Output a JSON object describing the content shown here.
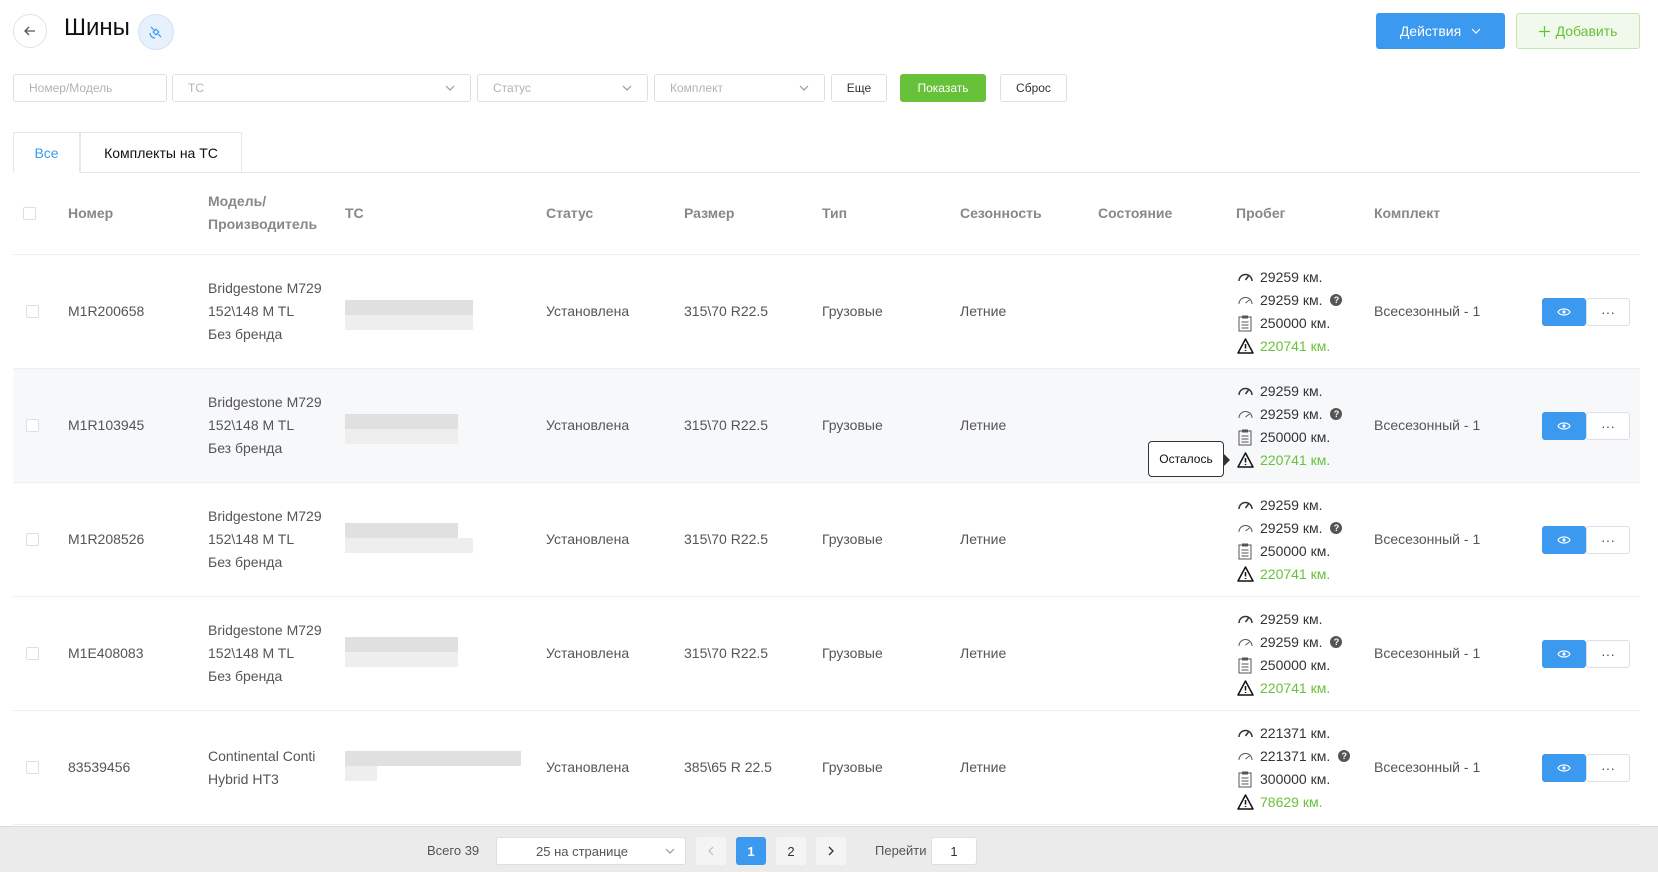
{
  "header": {
    "title": "Шины",
    "actions_label": "Действия",
    "add_label": "Добавить"
  },
  "filters": {
    "number_model_placeholder": "Номер/Модель",
    "vehicle_placeholder": "ТС",
    "status_placeholder": "Статус",
    "set_placeholder": "Комплект",
    "more_label": "Еще",
    "show_label": "Показать",
    "reset_label": "Сброс"
  },
  "tabs": [
    {
      "label": "Все",
      "active": true
    },
    {
      "label": "Комплекты на ТС",
      "active": false
    }
  ],
  "table": {
    "columns": [
      "Номер",
      "Модель/Производитель",
      "ТС",
      "Статус",
      "Размер",
      "Тип",
      "Сезонность",
      "Состояние",
      "Пробег",
      "Комплект"
    ],
    "rows": [
      {
        "number": "M1R200658",
        "model": [
          "Bridgestone M729",
          "152\\148 M TL",
          "Без бренда"
        ],
        "status": "Установлена",
        "size": "315\\70 R22.5",
        "type": "Грузовые",
        "season": "Летние",
        "condition": "",
        "mileage": [
          "29259 км.",
          "29259 км.",
          "250000 км.",
          "220741 км."
        ],
        "set": "Всесезонный - 1"
      },
      {
        "number": "M1R103945",
        "model": [
          "Bridgestone M729",
          "152\\148 M TL",
          "Без бренда"
        ],
        "status": "Установлена",
        "size": "315\\70 R22.5",
        "type": "Грузовые",
        "season": "Летние",
        "condition": "",
        "mileage": [
          "29259 км.",
          "29259 км.",
          "250000 км.",
          "220741 км."
        ],
        "set": "Всесезонный - 1"
      },
      {
        "number": "M1R208526",
        "model": [
          "Bridgestone M729",
          "152\\148 M TL",
          "Без бренда"
        ],
        "status": "Установлена",
        "size": "315\\70 R22.5",
        "type": "Грузовые",
        "season": "Летние",
        "condition": "",
        "mileage": [
          "29259 км.",
          "29259 км.",
          "250000 км.",
          "220741 км."
        ],
        "set": "Всесезонный - 1"
      },
      {
        "number": "M1E408083",
        "model": [
          "Bridgestone M729",
          "152\\148 M TL",
          "Без бренда"
        ],
        "status": "Установлена",
        "size": "315\\70 R22.5",
        "type": "Грузовые",
        "season": "Летние",
        "condition": "",
        "mileage": [
          "29259 км.",
          "29259 км.",
          "250000 км.",
          "220741 км."
        ],
        "set": "Всесезонный - 1"
      },
      {
        "number": "83539456",
        "model": [
          "Continental Conti",
          "Hybrid HT3"
        ],
        "status": "Установлена",
        "size": "385\\65 R 22.5",
        "type": "Грузовые",
        "season": "Летние",
        "condition": "",
        "mileage": [
          "221371 км.",
          "221371 км.",
          "300000 км.",
          "78629 км."
        ],
        "set": "Всесезонный - 1"
      }
    ]
  },
  "tooltip": "Осталось",
  "pagination": {
    "total": "Всего 39",
    "page_size": "25 на странице",
    "pages": [
      "1",
      "2"
    ],
    "current": "1",
    "goto_label": "Перейти",
    "goto_value": "1"
  },
  "colors": {
    "primary": "#3b99f0",
    "success": "#67c23a"
  },
  "icons": [
    "arrow-left-icon",
    "satellite-icon",
    "chevron-down-icon",
    "plus-icon",
    "speedometer-icon",
    "speedometer-outline-icon",
    "clipboard-icon",
    "warning-icon",
    "question-icon",
    "eye-icon",
    "ellipsis-icon",
    "chevron-left-icon",
    "chevron-right-icon"
  ]
}
